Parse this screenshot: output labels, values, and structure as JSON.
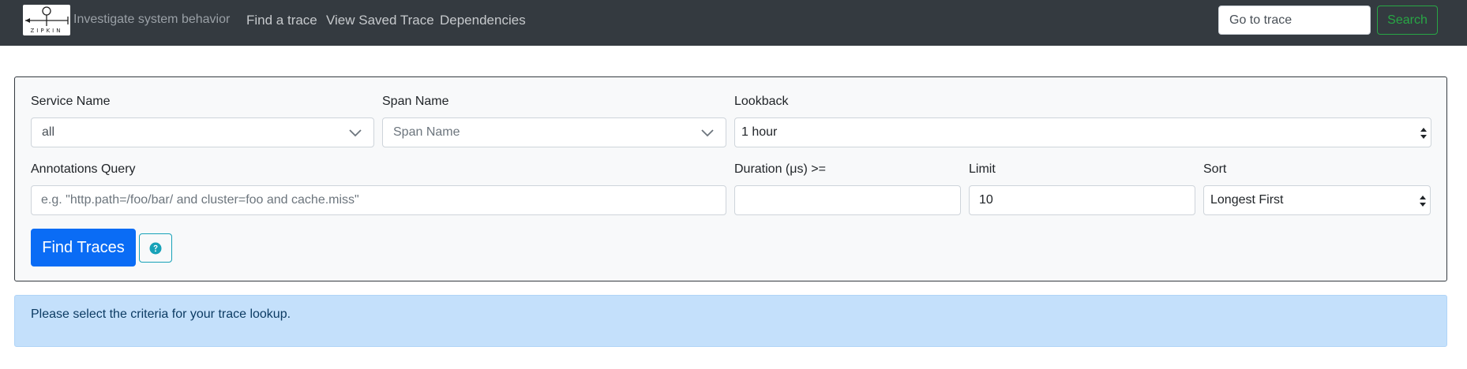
{
  "header": {
    "logo_text": "ZIPKIN",
    "tagline": "Investigate system behavior",
    "nav": [
      {
        "label": "Find a trace"
      },
      {
        "label": "View Saved Trace"
      },
      {
        "label": "Dependencies"
      }
    ],
    "goto_placeholder": "Go to trace",
    "search_label": "Search"
  },
  "form": {
    "service_name": {
      "label": "Service Name",
      "value": "all"
    },
    "span_name": {
      "label": "Span Name",
      "value": "Span Name"
    },
    "lookback": {
      "label": "Lookback",
      "value": "1 hour"
    },
    "annotations": {
      "label": "Annotations Query",
      "placeholder": "e.g. \"http.path=/foo/bar/ and cluster=foo and cache.miss\""
    },
    "duration": {
      "label": "Duration (μs) >=",
      "value": ""
    },
    "limit": {
      "label": "Limit",
      "value": "10"
    },
    "sort": {
      "label": "Sort",
      "value": "Longest First"
    },
    "find_label": "Find Traces",
    "help_icon": "question-circle-icon"
  },
  "alert": {
    "message": "Please select the criteria for your trace lookup."
  },
  "colors": {
    "navbar": "#343a40",
    "primary": "#0a6cf5",
    "success": "#28a745",
    "info": "#17a2b8",
    "alert_bg": "#c4e0fb"
  }
}
